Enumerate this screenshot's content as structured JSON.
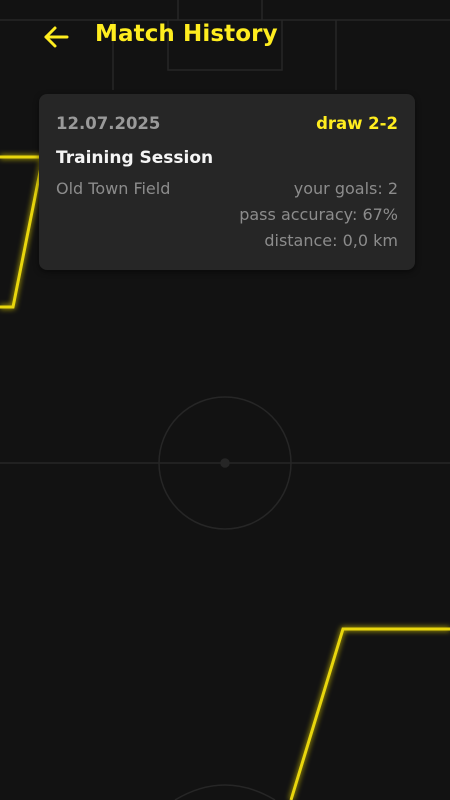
{
  "header": {
    "back_icon": "arrow-left-icon",
    "title": "Match History"
  },
  "colors": {
    "background": "#121212",
    "accent": "#ffed1f",
    "card": "#262626",
    "text_primary": "#f5f5f5",
    "text_secondary": "#8c8c8c",
    "field_lines": "#2a2a2a"
  },
  "matches": [
    {
      "date": "12.07.2025",
      "result": "draw 2-2",
      "title": "Training Session",
      "location": "Old Town Field",
      "goals": "your goals: 2",
      "pass_accuracy": "pass accuracy: 67%",
      "distance": "distance: 0,0 km"
    }
  ]
}
